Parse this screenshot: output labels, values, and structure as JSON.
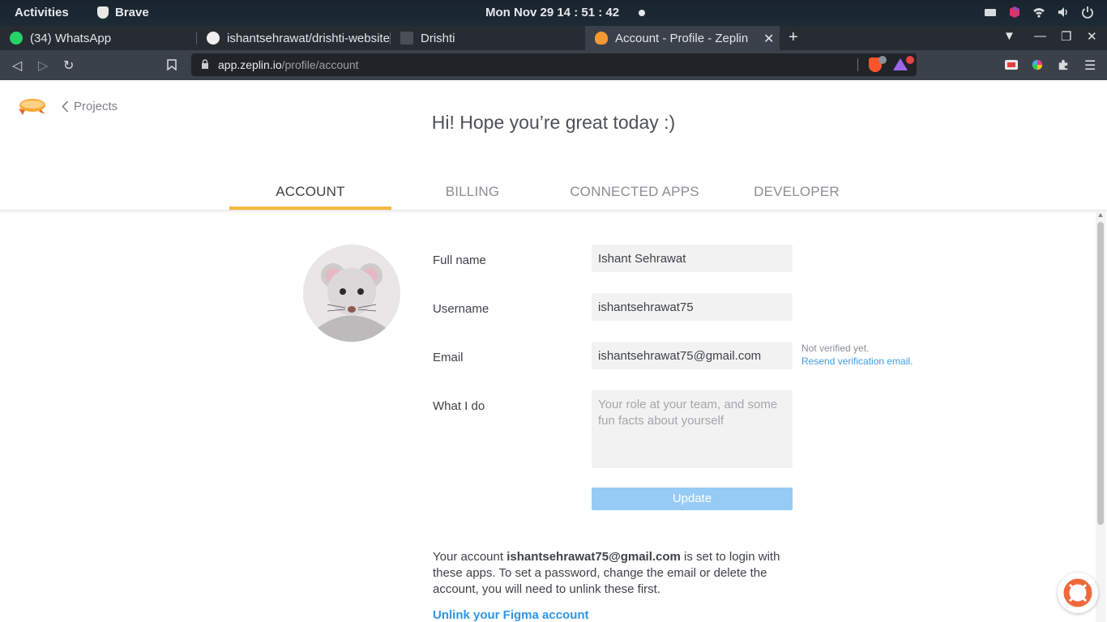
{
  "system_bar": {
    "activities": "Activities",
    "app_name": "Brave",
    "clock": "Mon Nov 29  14 : 51 : 42"
  },
  "tabs": [
    {
      "label": "(34) WhatsApp",
      "badge": "34",
      "icon": "whatsapp-icon"
    },
    {
      "label": "ishantsehrawat/drishti-website",
      "icon": "github-icon"
    },
    {
      "label": "Drishti",
      "icon": "page-icon"
    },
    {
      "label": "Account - Profile - Zeplin",
      "icon": "zeplin-icon",
      "active": true
    }
  ],
  "address_bar": {
    "host": "app.zeplin.io",
    "path": "/profile/account"
  },
  "page": {
    "back_link": "Projects",
    "greeting": "Hi! Hope you’re great today :)",
    "profile_tabs": [
      {
        "label": "ACCOUNT",
        "active": true
      },
      {
        "label": "BILLING",
        "active": false
      },
      {
        "label": "CONNECTED APPS",
        "active": false
      },
      {
        "label": "DEVELOPER",
        "active": false
      }
    ],
    "form": {
      "full_name_label": "Full name",
      "full_name_value": "Ishant Sehrawat",
      "username_label": "Username",
      "username_value": "ishantsehrawat75",
      "email_label": "Email",
      "email_value": "ishantsehrawat75@gmail.com",
      "email_status": "Not verified yet.",
      "resend_link": "Resend verification email.",
      "what_i_do_label": "What I do",
      "what_i_do_placeholder": "Your role at your team, and some fun facts about yourself",
      "update_button": "Update"
    },
    "info": {
      "prefix": "Your account ",
      "email": "ishantsehrawat75@gmail.com",
      "suffix": " is set to login with these apps. To set a password, change the email or delete the account, you will need to unlink these first."
    },
    "unlink_link": "Unlink your Figma account"
  },
  "colors": {
    "accent_tab_underline": "#f6b83d",
    "update_button_bg": "#96cbf5",
    "link_blue": "#2f95e3",
    "browser_chrome": "#3b414a"
  }
}
